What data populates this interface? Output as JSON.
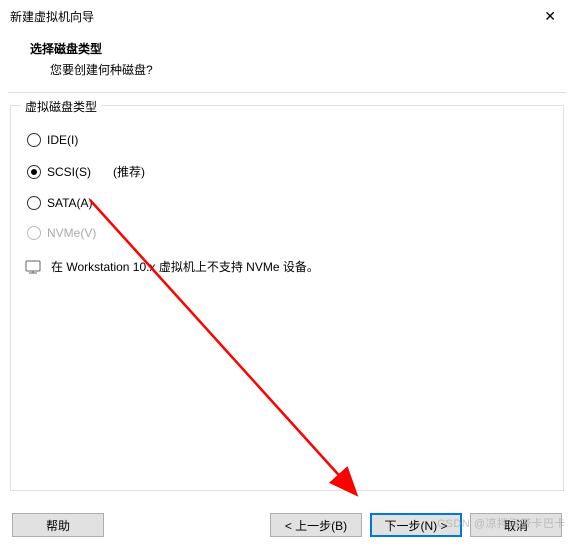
{
  "window": {
    "title": "新建虚拟机向导"
  },
  "header": {
    "heading": "选择磁盘类型",
    "subheading": "您要创建何种磁盘?"
  },
  "group": {
    "label": "虚拟磁盘类型",
    "options": {
      "ide": {
        "label": "IDE(I)"
      },
      "scsi": {
        "label": "SCSI(S)",
        "recommend": "(推荐)"
      },
      "sata": {
        "label": "SATA(A)"
      },
      "nvme": {
        "label": "NVMe(V)"
      }
    },
    "info": "在 Workstation 10.x 虚拟机上不支持 NVMe 设备。"
  },
  "buttons": {
    "help": "帮助",
    "back": "< 上一步(B)",
    "next": "下一步(N) >",
    "cancel": "取消"
  },
  "watermark": "CSDN @凉拌海带卡巴卡"
}
